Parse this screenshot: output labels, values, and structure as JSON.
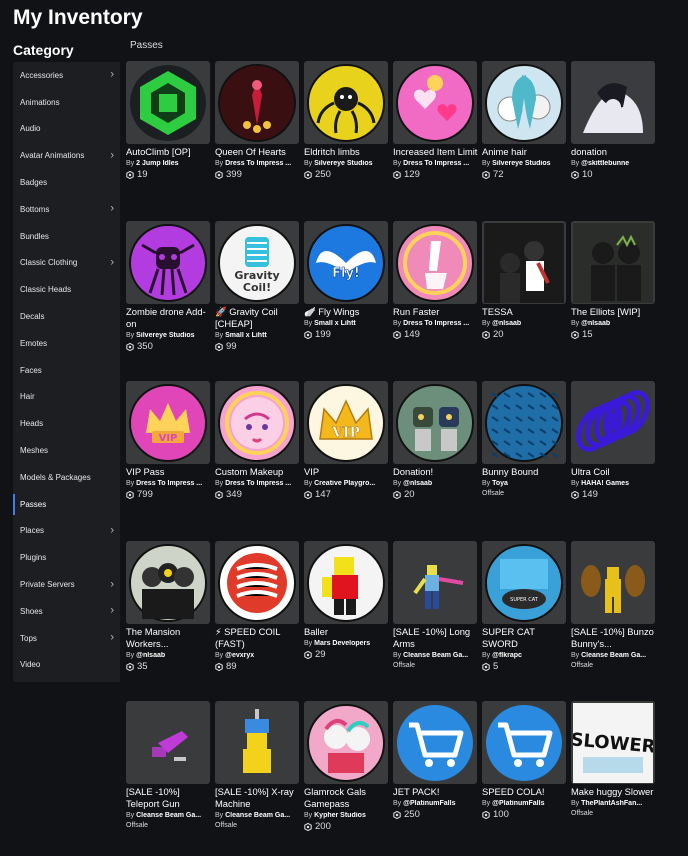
{
  "page_title": "My Inventory",
  "category_title": "Category",
  "section_label": "Passes",
  "sidebar": [
    {
      "label": "Accessories",
      "chevron": true
    },
    {
      "label": "Animations",
      "chevron": false
    },
    {
      "label": "Audio",
      "chevron": false
    },
    {
      "label": "Avatar Animations",
      "chevron": true
    },
    {
      "label": "Badges",
      "chevron": false
    },
    {
      "label": "Bottoms",
      "chevron": true
    },
    {
      "label": "Bundles",
      "chevron": false
    },
    {
      "label": "Classic Clothing",
      "chevron": true
    },
    {
      "label": "Classic Heads",
      "chevron": false
    },
    {
      "label": "Decals",
      "chevron": false
    },
    {
      "label": "Emotes",
      "chevron": false
    },
    {
      "label": "Faces",
      "chevron": false
    },
    {
      "label": "Hair",
      "chevron": false
    },
    {
      "label": "Heads",
      "chevron": false
    },
    {
      "label": "Meshes",
      "chevron": false
    },
    {
      "label": "Models & Packages",
      "chevron": false
    },
    {
      "label": "Passes",
      "chevron": false,
      "active": true
    },
    {
      "label": "Places",
      "chevron": true
    },
    {
      "label": "Plugins",
      "chevron": false
    },
    {
      "label": "Private Servers",
      "chevron": true
    },
    {
      "label": "Shoes",
      "chevron": true
    },
    {
      "label": "Tops",
      "chevron": true
    },
    {
      "label": "Video",
      "chevron": false
    }
  ],
  "items": [
    {
      "name": "AutoClimb [OP]",
      "creator": "2 Jump Idles",
      "price": "19",
      "icon": "green-robux-hexagon-icon",
      "bg": "#2e3338",
      "accent": "#2ecc40"
    },
    {
      "name": "Queen Of Hearts",
      "creator": "Dress To Impress ...",
      "price": "399",
      "icon": "queen-of-hearts-icon",
      "bg": "#3a0f12",
      "accent": "#c81d3a"
    },
    {
      "name": "Eldritch limbs",
      "creator": "Silvereye Studios",
      "price": "250",
      "icon": "eldritch-creature-icon",
      "bg": "#e8d21c",
      "accent": "#1a1a1a"
    },
    {
      "name": "Increased Item Limit",
      "creator": "Dress To Impress ...",
      "price": "129",
      "icon": "pink-hearts-icon",
      "bg": "#f16bc4",
      "accent": "#ffd35a"
    },
    {
      "name": "Anime hair",
      "creator": "Silvereye Studios",
      "price": "72",
      "icon": "anime-hair-icon",
      "bg": "#cfe6f0",
      "accent": "#4fb8c9"
    },
    {
      "name": "donation",
      "creator": "@skittlebunne",
      "price": "10",
      "icon": "dark-figure-icon",
      "bg": "#2a2a30",
      "accent": "#888"
    },
    {
      "name": "Zombie drone Add-on",
      "creator": "Silvereye Studios",
      "price": "350",
      "icon": "zombie-drone-icon",
      "bg": "#b33ce0",
      "accent": "#2a1030"
    },
    {
      "name": "🚀 Gravity Coil [CHEAP]",
      "creator": "Small x Lihtt",
      "price": "99",
      "icon": "gravity-coil-icon",
      "bg": "#f4f4f4",
      "accent": "#35c0e0"
    },
    {
      "name": "🪽 Fly Wings",
      "creator": "Small x Lihtt",
      "price": "199",
      "icon": "fly-wings-icon",
      "bg": "#1d78e0",
      "accent": "#ffffff"
    },
    {
      "name": "Run Faster",
      "creator": "Dress To Impress ...",
      "price": "149",
      "icon": "run-faster-icon",
      "bg": "#f08ab8",
      "accent": "#ffd35a"
    },
    {
      "name": "TESSA",
      "creator": "@nlsaab",
      "price": "20",
      "icon": "character-silhouettes-icon",
      "bg": "#1a1a1a",
      "accent": "#e8e8e8"
    },
    {
      "name": "The Elliots [WIP]",
      "creator": "@nlsaab",
      "price": "15",
      "icon": "dark-characters-icon",
      "bg": "#2a2d2a",
      "accent": "#7db24a"
    },
    {
      "name": "VIP Pass",
      "creator": "Dress To Impress ...",
      "price": "799",
      "icon": "vip-crown-pink-icon",
      "bg": "#e046b8",
      "accent": "#ffd35a"
    },
    {
      "name": "Custom Makeup",
      "creator": "Dress To Impress ...",
      "price": "349",
      "icon": "makeup-icon",
      "bg": "#f6a3cf",
      "accent": "#ffd35a"
    },
    {
      "name": "VIP",
      "creator": "Creative Playgro...",
      "price": "147",
      "icon": "vip-crown-gold-icon",
      "bg": "#fdf6e0",
      "accent": "#f2b81c"
    },
    {
      "name": "Donation!",
      "creator": "@nlsaab",
      "price": "20",
      "icon": "donation-characters-icon",
      "bg": "#6b8f7a",
      "accent": "#f2d45a"
    },
    {
      "name": "Bunny Bound",
      "creator": "Toya",
      "price": null,
      "offsale": "Offsale",
      "icon": "blue-pattern-icon",
      "bg": "#1f6ea8",
      "accent": "#0c3f6a"
    },
    {
      "name": "Ultra Coil",
      "creator": "HAHA! Games",
      "price": "149",
      "icon": "purple-coil-icon",
      "bg": "#393b3d",
      "accent": "#3a1ad8"
    },
    {
      "name": "The Mansion Workers...",
      "creator": "@nlsaab",
      "price": "35",
      "icon": "mansion-workers-icon",
      "bg": "#cfd4c8",
      "accent": "#222"
    },
    {
      "name": "⚡ SPEED COIL (FAST)",
      "creator": "@evxryx",
      "price": "89",
      "icon": "speed-coil-icon",
      "bg": "#ffffff",
      "accent": "#e03a2a"
    },
    {
      "name": "Baller",
      "creator": "Mars Developers",
      "price": "29",
      "icon": "baller-icon",
      "bg": "#f4f4f4",
      "accent": "#e0141e"
    },
    {
      "name": "[SALE -10%] Long Arms",
      "creator": "Cleanse Beam Ga...",
      "price": null,
      "offsale": "Offsale",
      "icon": "long-arms-icon",
      "bg": "#393b3d",
      "accent": "#e8e04a"
    },
    {
      "name": "SUPER CAT SWORD",
      "creator": "@flkrapc",
      "price": "5",
      "icon": "super-cat-sword-icon",
      "bg": "#3aa0d8",
      "accent": "#2a2a2a"
    },
    {
      "name": "[SALE -10%] Bunzo Bunny's...",
      "creator": "Cleanse Beam Ga...",
      "price": null,
      "offsale": "Offsale",
      "icon": "cymbals-icon",
      "bg": "#393b3d",
      "accent": "#e8c01a"
    },
    {
      "name": "[SALE -10%] Teleport Gun",
      "creator": "Cleanse Beam Ga...",
      "price": null,
      "offsale": "Offsale",
      "icon": "teleport-gun-icon",
      "bg": "#393b3d",
      "accent": "#c03ad8"
    },
    {
      "name": "[SALE -10%] X-ray Machine",
      "creator": "Cleanse Beam Ga...",
      "price": null,
      "offsale": "Offsale",
      "icon": "xray-machine-icon",
      "bg": "#393b3d",
      "accent": "#f2d21a"
    },
    {
      "name": "Glamrock Gals Gamepass",
      "creator": "Kypher Studios",
      "price": "200",
      "icon": "glamrock-gals-icon",
      "bg": "#f2a8c8",
      "accent": "#e0407a"
    },
    {
      "name": "JET PACK!",
      "creator": "@PlatinumFalls",
      "price": "250",
      "icon": "shopping-cart-icon",
      "bg": "#2a8ae0",
      "accent": "#ffffff"
    },
    {
      "name": "SPEED COLA!",
      "creator": "@PlatinumFalls",
      "price": "100",
      "icon": "shopping-cart-icon",
      "bg": "#2a8ae0",
      "accent": "#ffffff"
    },
    {
      "name": "Make huggy Slower",
      "creator": "ThePlantAshFan...",
      "price": null,
      "offsale": "Offsale",
      "icon": "slower-text-icon",
      "bg": "#f4f4f4",
      "accent": "#111111"
    }
  ]
}
